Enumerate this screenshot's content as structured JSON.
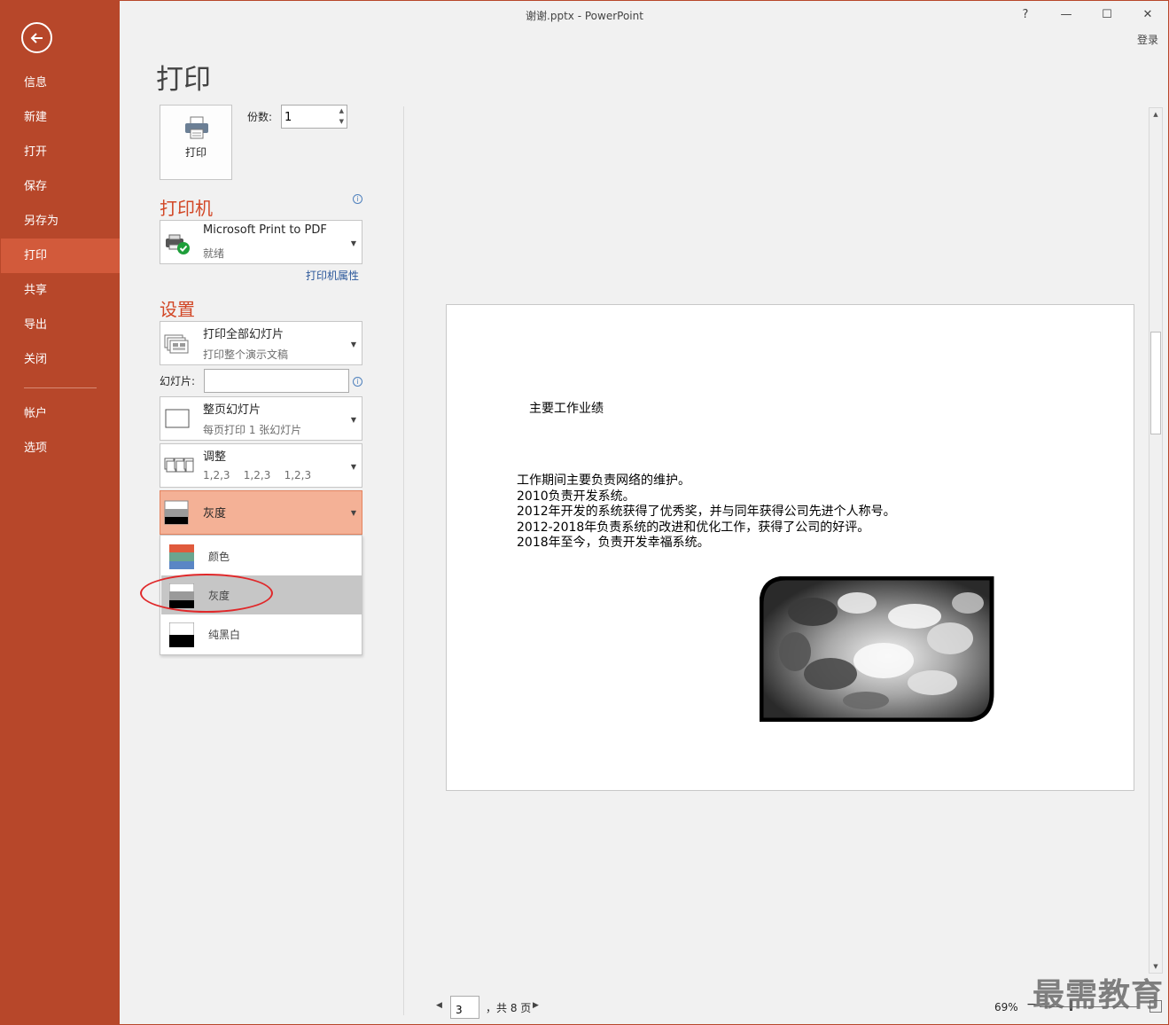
{
  "window": {
    "title": "谢谢.pptx - PowerPoint",
    "help": "?",
    "minimize": "—",
    "maximize": "☐",
    "close": "✕",
    "login": "登录"
  },
  "sidebar": {
    "back_icon": "arrow-left-icon",
    "items": [
      {
        "label": "信息"
      },
      {
        "label": "新建"
      },
      {
        "label": "打开"
      },
      {
        "label": "保存"
      },
      {
        "label": "另存为"
      },
      {
        "label": "打印"
      },
      {
        "label": "共享"
      },
      {
        "label": "导出"
      },
      {
        "label": "关闭"
      },
      {
        "label": "帐户"
      },
      {
        "label": "选项"
      }
    ],
    "active": "打印",
    "color": "#b7472a",
    "active_color": "#d25a3b"
  },
  "print": {
    "page_title": "打印",
    "button_label": "打印",
    "copies_label": "份数:",
    "copies_value": "1"
  },
  "printer": {
    "heading": "打印机",
    "name": "Microsoft Print to PDF",
    "status": "就绪",
    "properties_link": "打印机属性"
  },
  "settings": {
    "heading": "设置",
    "range": {
      "title": "打印全部幻灯片",
      "subtitle": "打印整个演示文稿"
    },
    "slides_label": "幻灯片:",
    "slides_value": "",
    "layout": {
      "title": "整页幻灯片",
      "subtitle": "每页打印 1 张幻灯片"
    },
    "collate": {
      "title": "调整",
      "subtitle": "1,2,3    1,2,3    1,2,3"
    },
    "color": {
      "selected": "灰度"
    },
    "color_options": [
      {
        "label": "颜色",
        "icon": "color-icon"
      },
      {
        "label": "灰度",
        "icon": "grayscale-icon"
      },
      {
        "label": "纯黑白",
        "icon": "black-white-icon"
      }
    ],
    "accent": "#f4b196"
  },
  "preview": {
    "slide_title": "主要工作业绩",
    "slide_lines": [
      "工作期间主要负责网络的维护。",
      "2010负责开发系统。",
      "2012年开发的系统获得了优秀奖，并与同年获得公司先进个人称号。",
      "2012-2018年负责系统的改进和优化工作，获得了公司的好评。",
      "2018年至今，负责开发幸福系统。"
    ]
  },
  "footer": {
    "page_current": "3",
    "page_total": "，共 8 页",
    "zoom": "69%",
    "zoom_fraction": 0.3,
    "watermark": "最需教育"
  }
}
